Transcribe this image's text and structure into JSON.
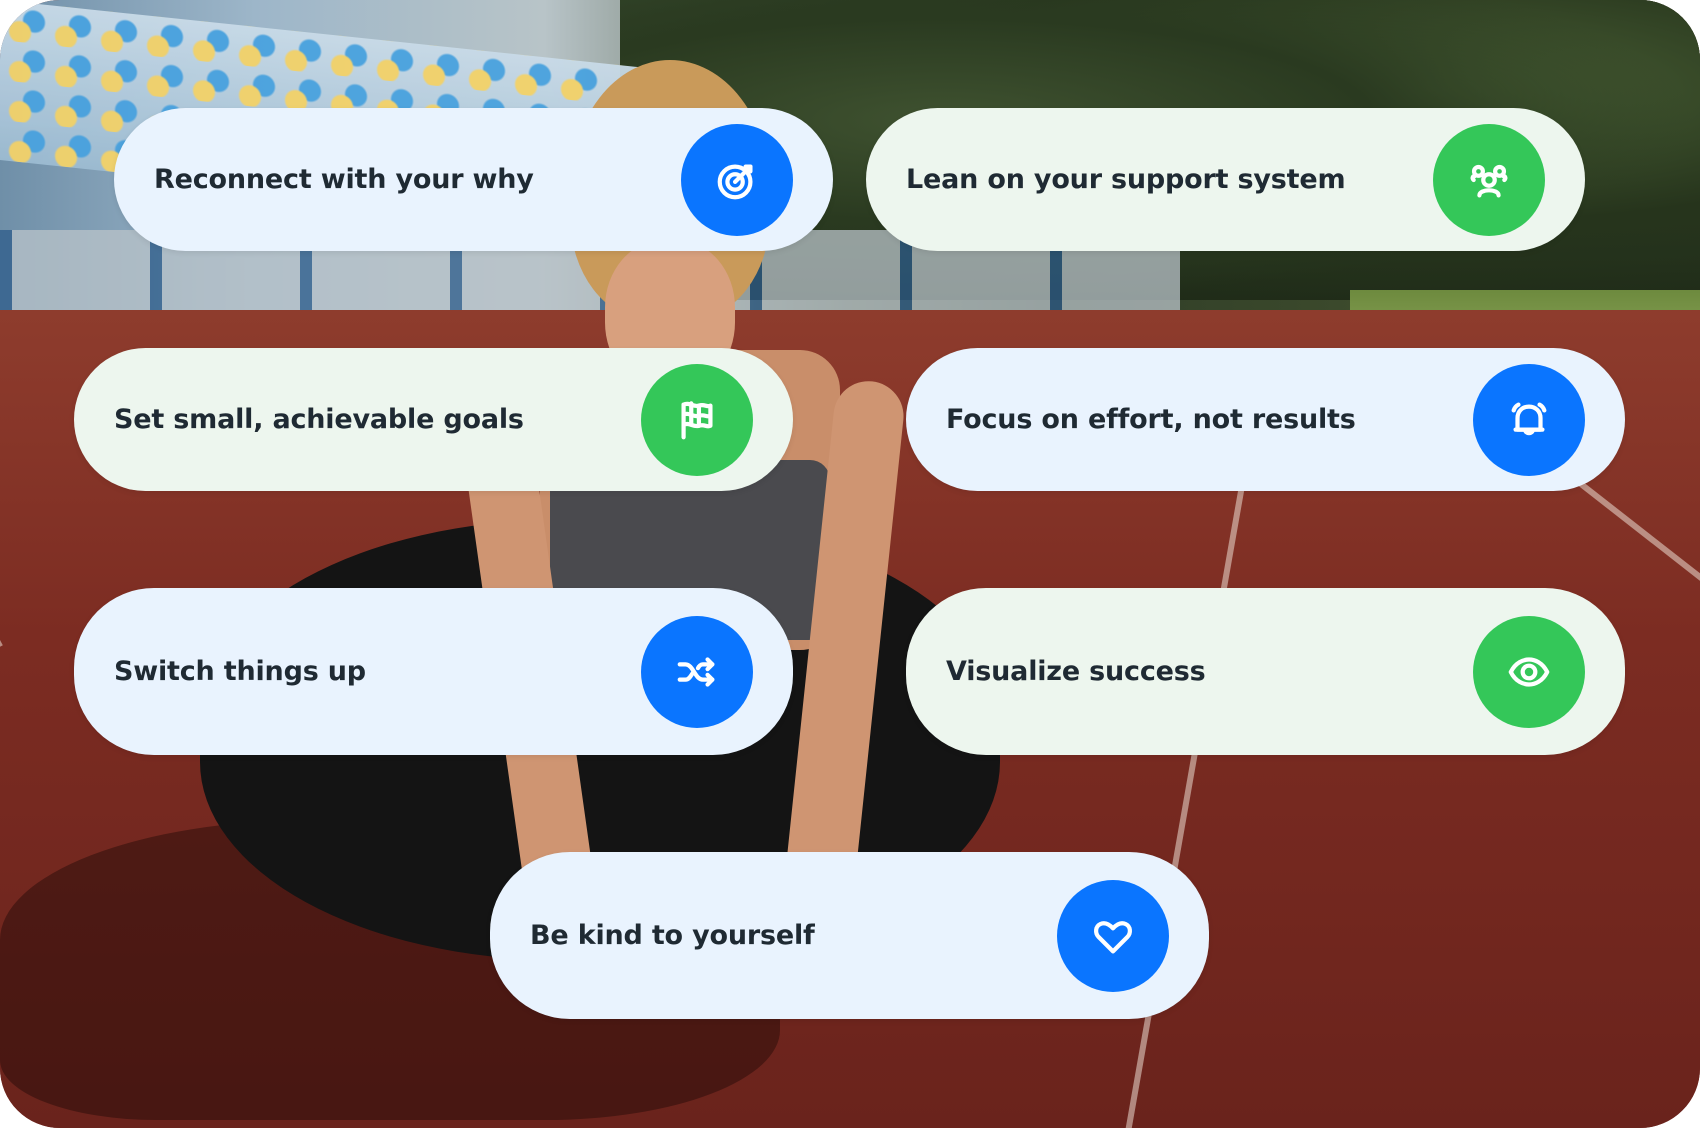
{
  "colors": {
    "blue_accent": "#0a75ff",
    "green_accent": "#34c759",
    "blue_pill_bg": "#e9f3fe",
    "green_pill_bg": "#edf6ee",
    "label_text": "#1f2a33"
  },
  "background": {
    "description": "Woman sitting on a red running track in a stadium, tying her shoe"
  },
  "tips": [
    {
      "label": "Reconnect with your why",
      "icon": "target-icon",
      "theme": "blue"
    },
    {
      "label": "Lean on your support system",
      "icon": "users-group-icon",
      "theme": "green"
    },
    {
      "label": "Set small, achievable goals",
      "icon": "checkered-flag-icon",
      "theme": "green"
    },
    {
      "label": "Focus on effort, not results",
      "icon": "alarm-bell-icon",
      "theme": "blue"
    },
    {
      "label": "Switch things up",
      "icon": "shuffle-icon",
      "theme": "blue"
    },
    {
      "label": "Visualize success",
      "icon": "eye-icon",
      "theme": "green"
    },
    {
      "label": "Be kind to yourself",
      "icon": "heart-icon",
      "theme": "blue"
    }
  ]
}
